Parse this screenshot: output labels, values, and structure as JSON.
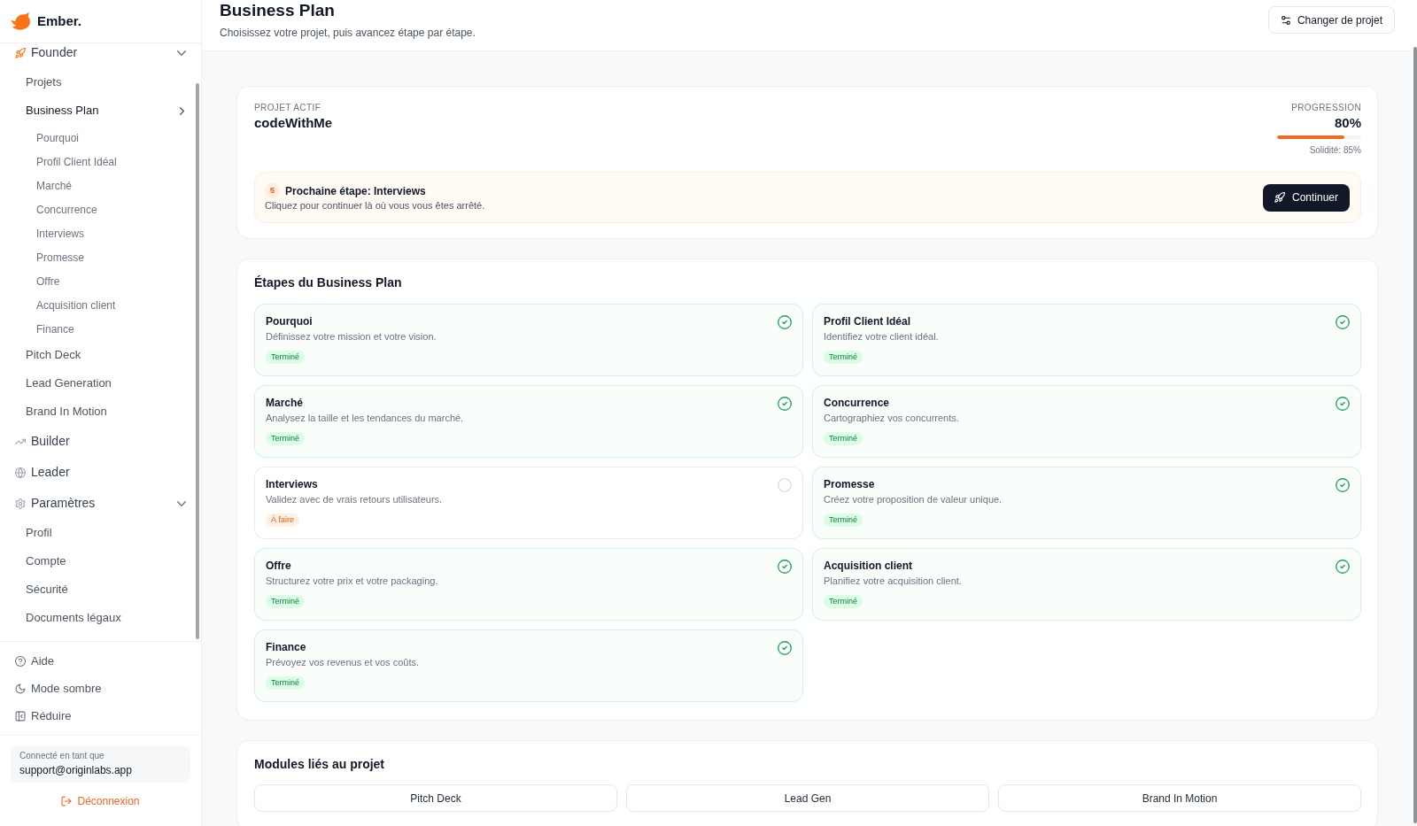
{
  "sidebar": {
    "brand": "Ember.",
    "nav": [
      {
        "label": "Founder",
        "active": true,
        "expanded": true,
        "children": [
          {
            "label": "Projets",
            "selected": false
          },
          {
            "label": "Business Plan",
            "selected": true,
            "children": [
              {
                "label": "Pourquoi",
                "selected": false
              },
              {
                "label": "Profil Client Idéal",
                "selected": false
              },
              {
                "label": "Marché",
                "selected": false
              },
              {
                "label": "Concurrence",
                "selected": false
              },
              {
                "label": "Interviews",
                "selected": false
              },
              {
                "label": "Promesse",
                "selected": false
              },
              {
                "label": "Offre",
                "selected": false
              },
              {
                "label": "Acquisition client",
                "selected": false
              },
              {
                "label": "Finance",
                "selected": false
              }
            ]
          },
          {
            "label": "Pitch Deck",
            "selected": false
          },
          {
            "label": "Lead Generation",
            "selected": false
          },
          {
            "label": "Brand In Motion",
            "selected": false
          }
        ]
      },
      {
        "label": "Builder",
        "active": false
      },
      {
        "label": "Leader",
        "active": false
      },
      {
        "label": "Paramètres",
        "active": false,
        "expanded": true,
        "children": [
          {
            "label": "Profil",
            "selected": false
          },
          {
            "label": "Compte",
            "selected": false
          },
          {
            "label": "Sécurité",
            "selected": false
          },
          {
            "label": "Documents légaux",
            "selected": false
          }
        ]
      }
    ],
    "footer_items": [
      "Aide",
      "Mode sombre",
      "Réduire"
    ],
    "user": {
      "caption": "Connecté en tant que",
      "email": "support@originlabs.app"
    },
    "logout": "Déconnexion"
  },
  "header": {
    "title": "Business Plan",
    "subtitle": "Choisissez votre projet, puis avancez étape par étape.",
    "action": "Changer de projet"
  },
  "project": {
    "label": "PROJET ACTIF",
    "name": "codeWithMe",
    "progress": {
      "label": "PROGRESSION",
      "value": "80%",
      "level": 0.8,
      "note": "Solidité: 85%"
    },
    "next_step": {
      "number": "5",
      "title": "Prochaine étape: Interviews",
      "text": "Cliquez pour continuer là où vous vous êtes arrêté.",
      "button": "Continuer"
    }
  },
  "steps": {
    "title": "Étapes du Business Plan",
    "items": [
      {
        "title": "Pourquoi",
        "description": "Définissez votre mission et votre vision.",
        "status": "Terminé",
        "completed": true
      },
      {
        "title": "Profil Client Idéal",
        "description": "Identifiez votre client idéal.",
        "status": "Terminé",
        "completed": true
      },
      {
        "title": "Marché",
        "description": "Analysez la taille et les tendances du marché.",
        "status": "Terminé",
        "completed": true
      },
      {
        "title": "Concurrence",
        "description": "Cartographiez vos concurrents.",
        "status": "Terminé",
        "completed": true
      },
      {
        "title": "Interviews",
        "description": "Validez avec de vrais retours utilisateurs.",
        "status": "À faire",
        "completed": false
      },
      {
        "title": "Promesse",
        "description": "Créez votre proposition de valeur unique.",
        "status": "Terminé",
        "completed": true
      },
      {
        "title": "Offre",
        "description": "Structurez votre prix et votre packaging.",
        "status": "Terminé",
        "completed": true
      },
      {
        "title": "Acquisition client",
        "description": "Planifiez votre acquisition client.",
        "status": "Terminé",
        "completed": true
      },
      {
        "title": "Finance",
        "description": "Prévoyez vos revenus et vos coûts.",
        "status": "Terminé",
        "completed": true
      }
    ]
  },
  "modules": {
    "title": "Modules liés au projet",
    "items": [
      "Pitch Deck",
      "Lead Gen",
      "Brand In Motion"
    ]
  }
}
